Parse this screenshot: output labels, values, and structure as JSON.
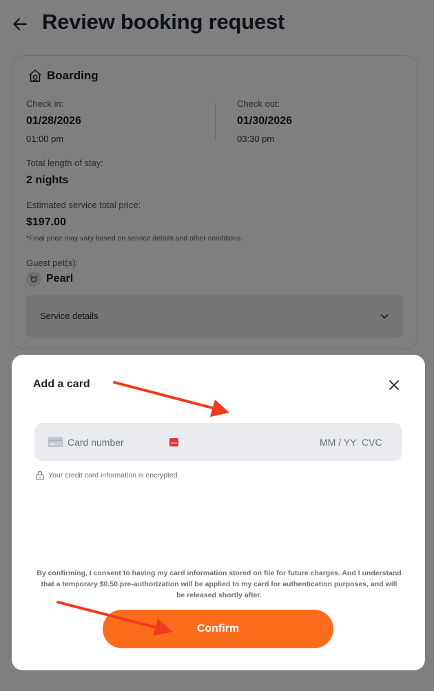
{
  "header": {
    "title": "Review booking request"
  },
  "booking": {
    "service": "Boarding",
    "check_in_label": "Check in:",
    "check_in_date": "01/28/2026",
    "check_in_time": "01:00 pm",
    "check_out_label": "Check out:",
    "check_out_date": "01/30/2026",
    "check_out_time": "03:30 pm",
    "stay_label": "Total length of stay:",
    "stay_value": "2 nights",
    "price_label": "Estimated service total price:",
    "price_value": "$197.00",
    "price_note": "*Final price may vary based on service details and other conditions.",
    "pets_label": "Guest pet(s):",
    "pet_name": "Pearl",
    "service_details": "Service details"
  },
  "modal": {
    "title": "Add a card",
    "card_number_placeholder": "Card number",
    "expiry_placeholder": "MM / YY",
    "cvc_placeholder": "CVC",
    "encrypted_note": "Your credit card information is encrypted.",
    "consent": "By confirming, I consent to having my card information stored on file for future charges. And I understand that a temporary $0.50 pre-authorization will be applied to my card for authentication purposes, and will be released shortly after.",
    "confirm_label": "Confirm"
  },
  "colors": {
    "accent": "#fb6c1d",
    "annotation_arrow": "#f23a1c",
    "overlay": "rgba(0,0,0,0.5)"
  },
  "icons": [
    "back-arrow-icon",
    "home-icon",
    "pet-avatar-icon",
    "chevron-down-icon",
    "close-icon",
    "credit-card-icon",
    "dots-icon",
    "lock-icon"
  ]
}
